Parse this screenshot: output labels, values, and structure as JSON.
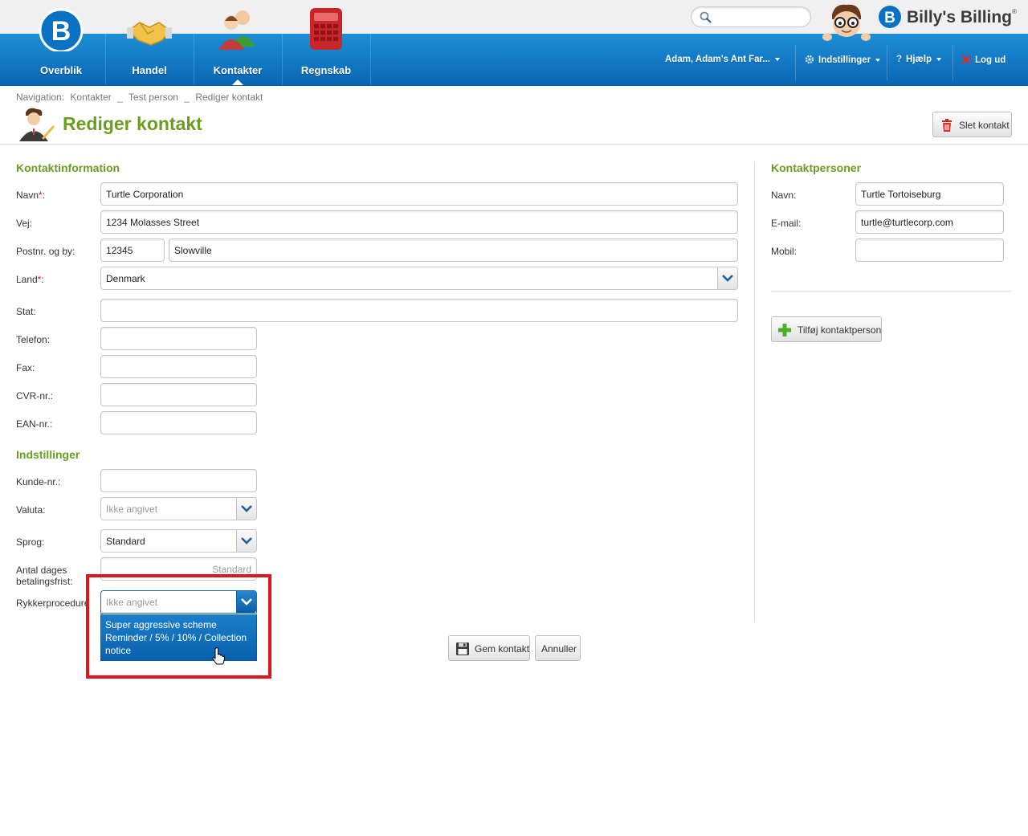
{
  "header": {
    "nav_tabs": [
      {
        "label": "Overblik"
      },
      {
        "label": "Handel"
      },
      {
        "label": "Kontakter"
      },
      {
        "label": "Regnskab"
      }
    ],
    "search_placeholder": "",
    "brand": "Billy's Billing",
    "brand_mark": "®",
    "user_menu": "Adam, Adam's Ant Far...",
    "settings_menu": "Indstillinger",
    "help_menu": "Hjælp",
    "logout": "Log ud",
    "active_tab": "Kontakter",
    "brand_color": "#0a66b5"
  },
  "breadcrumb": {
    "prefix": "Navigation:",
    "items": [
      "Kontakter",
      "_",
      "Test person",
      "_",
      "Rediger kontakt"
    ]
  },
  "page": {
    "title": "Rediger kontakt",
    "delete_button": "Slet kontakt",
    "title_color": "#6a9e1f"
  },
  "contact_info": {
    "section_title": "Kontaktinformation",
    "name_label": "Navn",
    "required_mark": "*",
    "name_value": "Turtle Corporation",
    "street_label": "Vej:",
    "street_value": "1234 Molasses Street",
    "zip_city_label": "Postnr. og by:",
    "zip_value": "12345",
    "city_value": "Slowville",
    "country_label": "Land",
    "country_value": "Denmark",
    "state_label": "Stat:",
    "state_value": "",
    "phone_label": "Telefon:",
    "phone_value": "",
    "fax_label": "Fax:",
    "fax_value": "",
    "cvr_label": "CVR-nr.:",
    "cvr_value": "",
    "ean_label": "EAN-nr.:",
    "ean_value": ""
  },
  "settings": {
    "section_title": "Indstillinger",
    "customer_no_label": "Kunde-nr.:",
    "customer_no_value": "",
    "currency_label": "Valuta:",
    "currency_value": "Ikke angivet",
    "language_label": "Sprog:",
    "language_value": "Standard",
    "payment_days_label_line1": "Antal dages",
    "payment_days_label_line2": "betalingsfrist:",
    "payment_days_placeholder": "Standard",
    "reminder_label": "Rykkerprocedure",
    "reminder_value": "Ikke angivet",
    "reminder_option": "Super aggressive scheme Reminder / 5% / 10% / Collection notice"
  },
  "contact_persons": {
    "section_title": "Kontaktpersoner",
    "name_label": "Navn:",
    "name_value": "Turtle Tortoiseburg",
    "email_label": "E-mail:",
    "email_value": "turtle@turtlecorp.com",
    "mobile_label": "Mobil:",
    "mobile_value": "",
    "add_button": "Tilføj kontaktperson"
  },
  "actions": {
    "save_button": "Gem kontakt",
    "cancel_button": "Annuller"
  },
  "icons": [
    "overview-b-icon",
    "handshake-icon",
    "contacts-people-icon",
    "calculator-icon",
    "search-icon",
    "mascot-icon",
    "brand-logo-icon",
    "gear-icon",
    "help-icon",
    "logout-x-icon",
    "edit-contact-icon",
    "trash-icon",
    "plus-icon",
    "floppy-disk-icon",
    "chevron-down-icon",
    "hand-cursor-icon"
  ]
}
